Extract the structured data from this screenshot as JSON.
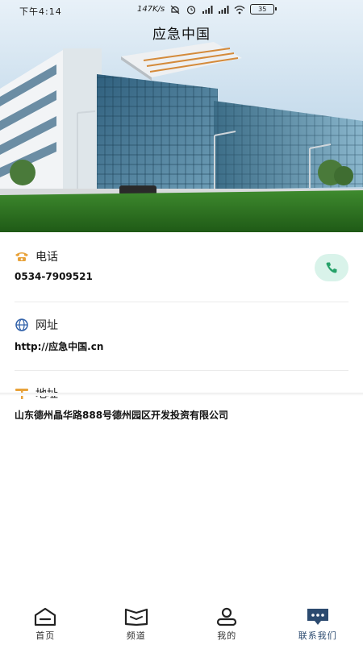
{
  "status_bar": {
    "time": "下午4:14",
    "network_speed": "147K/s",
    "battery": "35"
  },
  "header": {
    "title": "应急中国"
  },
  "contact": {
    "phone": {
      "label": "电话",
      "value": "0534-7909521"
    },
    "website": {
      "label": "网址",
      "value": "http://应急中国.cn"
    },
    "address": {
      "label": "地址",
      "value": "山东德州晶华路888号德州园区开发投资有限公司"
    }
  },
  "tabs": [
    {
      "label": "首页",
      "icon": "home-icon"
    },
    {
      "label": "频道",
      "icon": "book-icon"
    },
    {
      "label": "我的",
      "icon": "user-icon"
    },
    {
      "label": "联系我们",
      "icon": "chat-icon",
      "active": true
    }
  ],
  "colors": {
    "accent": "#e8a23a",
    "link_icon": "#2e5fa8",
    "call_bg": "#d9f3ea",
    "call_icon": "#27a26a",
    "active_tab": "#2b4a6f"
  }
}
